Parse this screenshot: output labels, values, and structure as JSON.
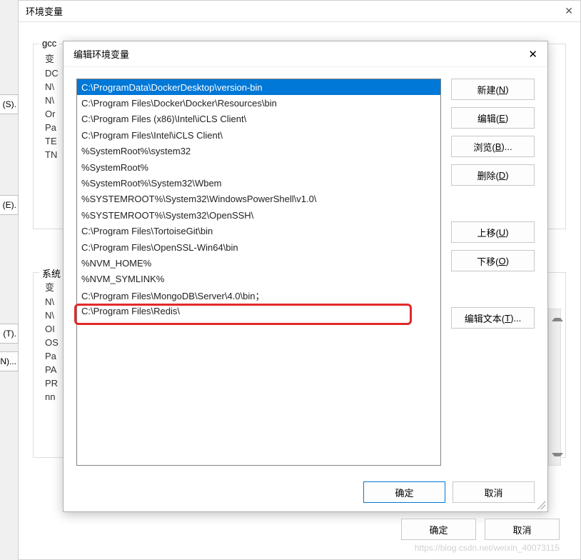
{
  "parent_window": {
    "title": "环境变量",
    "group1_label": "gcc",
    "group2_label": "系统",
    "left_col1": [
      "变",
      "DC",
      "N\\",
      "N\\",
      "Or",
      "Pa",
      "TE",
      "TN"
    ],
    "left_col2": [
      "变",
      "N\\",
      "N\\",
      "OI",
      "OS",
      "Pa",
      "PA",
      "PR",
      "nn"
    ]
  },
  "side_buttons": {
    "s": "(S).",
    "e": "(E).",
    "t": "(T).",
    "n": "N)..."
  },
  "dialog": {
    "title": "编辑环境变量",
    "paths": [
      "C:\\ProgramData\\DockerDesktop\\version-bin",
      "C:\\Program Files\\Docker\\Docker\\Resources\\bin",
      "C:\\Program Files (x86)\\Intel\\iCLS Client\\",
      "C:\\Program Files\\Intel\\iCLS Client\\",
      "%SystemRoot%\\system32",
      "%SystemRoot%",
      "%SystemRoot%\\System32\\Wbem",
      "%SYSTEMROOT%\\System32\\WindowsPowerShell\\v1.0\\",
      "%SYSTEMROOT%\\System32\\OpenSSH\\",
      "C:\\Program Files\\TortoiseGit\\bin",
      "C:\\Program Files\\OpenSSL-Win64\\bin",
      "%NVM_HOME%",
      "%NVM_SYMLINK%",
      "C:\\Program Files\\MongoDB\\Server\\4.0\\bin；",
      "C:\\Program Files\\Redis\\"
    ],
    "selected_index": 0,
    "highlighted_index": 13,
    "buttons": {
      "new": {
        "pre": "新建(",
        "hot": "N",
        "post": ")"
      },
      "edit": {
        "pre": "编辑(",
        "hot": "E",
        "post": ")"
      },
      "browse": {
        "pre": "浏览(",
        "hot": "B",
        "post": ")..."
      },
      "delete": {
        "pre": "删除(",
        "hot": "D",
        "post": ")"
      },
      "moveup": {
        "pre": "上移(",
        "hot": "U",
        "post": ")"
      },
      "movedown": {
        "pre": "下移(",
        "hot": "O",
        "post": ")"
      },
      "edittext": {
        "pre": "编辑文本(",
        "hot": "T",
        "post": ")..."
      }
    },
    "ok": "确定",
    "cancel": "取消"
  },
  "outer_footer": {
    "ok": "确定",
    "cancel": "取消"
  },
  "watermark": "https://blog.csdn.net/weixin_40073115"
}
